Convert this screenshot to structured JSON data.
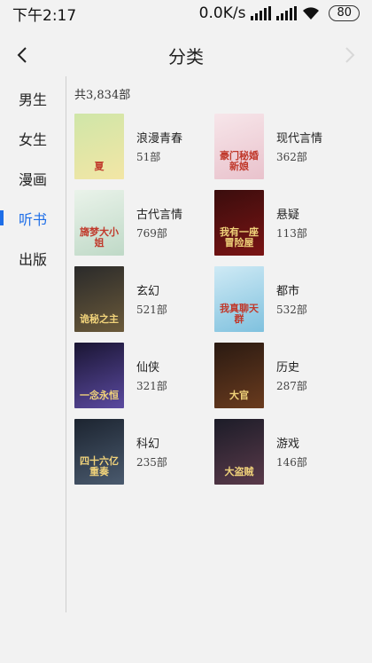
{
  "status": {
    "time": "下午2:17",
    "speed": "0.0K/s",
    "battery": "80"
  },
  "header": {
    "title": "分类"
  },
  "sidebar": {
    "items": [
      {
        "label": "男生"
      },
      {
        "label": "女生"
      },
      {
        "label": "漫画"
      },
      {
        "label": "听书"
      },
      {
        "label": "出版"
      }
    ],
    "active_index": 3,
    "accent": "#1e6ee8"
  },
  "content": {
    "total": "共3,834部",
    "categories": [
      {
        "name": "浪漫青春",
        "count": "51部",
        "cover_text": "夏",
        "cover_colors": [
          "#cfe6a8",
          "#f3e6a5"
        ]
      },
      {
        "name": "现代言情",
        "count": "362部",
        "cover_text": "豪门秘婚新娘",
        "cover_colors": [
          "#f7e6ea",
          "#e9c2cc"
        ]
      },
      {
        "name": "古代言情",
        "count": "769部",
        "cover_text": "旖梦大小姐",
        "cover_colors": [
          "#eaf3ea",
          "#bfd9c7"
        ]
      },
      {
        "name": "悬疑",
        "count": "113部",
        "cover_text": "我有一座冒险屋",
        "cover_colors": [
          "#3a0d0d",
          "#7a1414"
        ]
      },
      {
        "name": "玄幻",
        "count": "521部",
        "cover_text": "诡秘之主",
        "cover_colors": [
          "#2a2a2a",
          "#6b5a3a"
        ]
      },
      {
        "name": "都市",
        "count": "532部",
        "cover_text": "我真聊天群",
        "cover_colors": [
          "#cfeaf5",
          "#7fc1de"
        ]
      },
      {
        "name": "仙侠",
        "count": "321部",
        "cover_text": "一念永恒",
        "cover_colors": [
          "#1a1533",
          "#5b4aa0"
        ]
      },
      {
        "name": "历史",
        "count": "287部",
        "cover_text": "大官",
        "cover_colors": [
          "#2a1a12",
          "#6a3b1e"
        ]
      },
      {
        "name": "科幻",
        "count": "235部",
        "cover_text": "四十六亿重奏",
        "cover_colors": [
          "#1c2430",
          "#4a5a6e"
        ]
      },
      {
        "name": "游戏",
        "count": "146部",
        "cover_text": "大盗贼",
        "cover_colors": [
          "#1c1c28",
          "#5a3a4a"
        ]
      }
    ]
  },
  "icons": {
    "back": "chevron-left-icon",
    "forward": "chevron-right-icon",
    "signal": "signal-icon",
    "wifi": "wifi-icon",
    "battery": "battery-icon"
  }
}
